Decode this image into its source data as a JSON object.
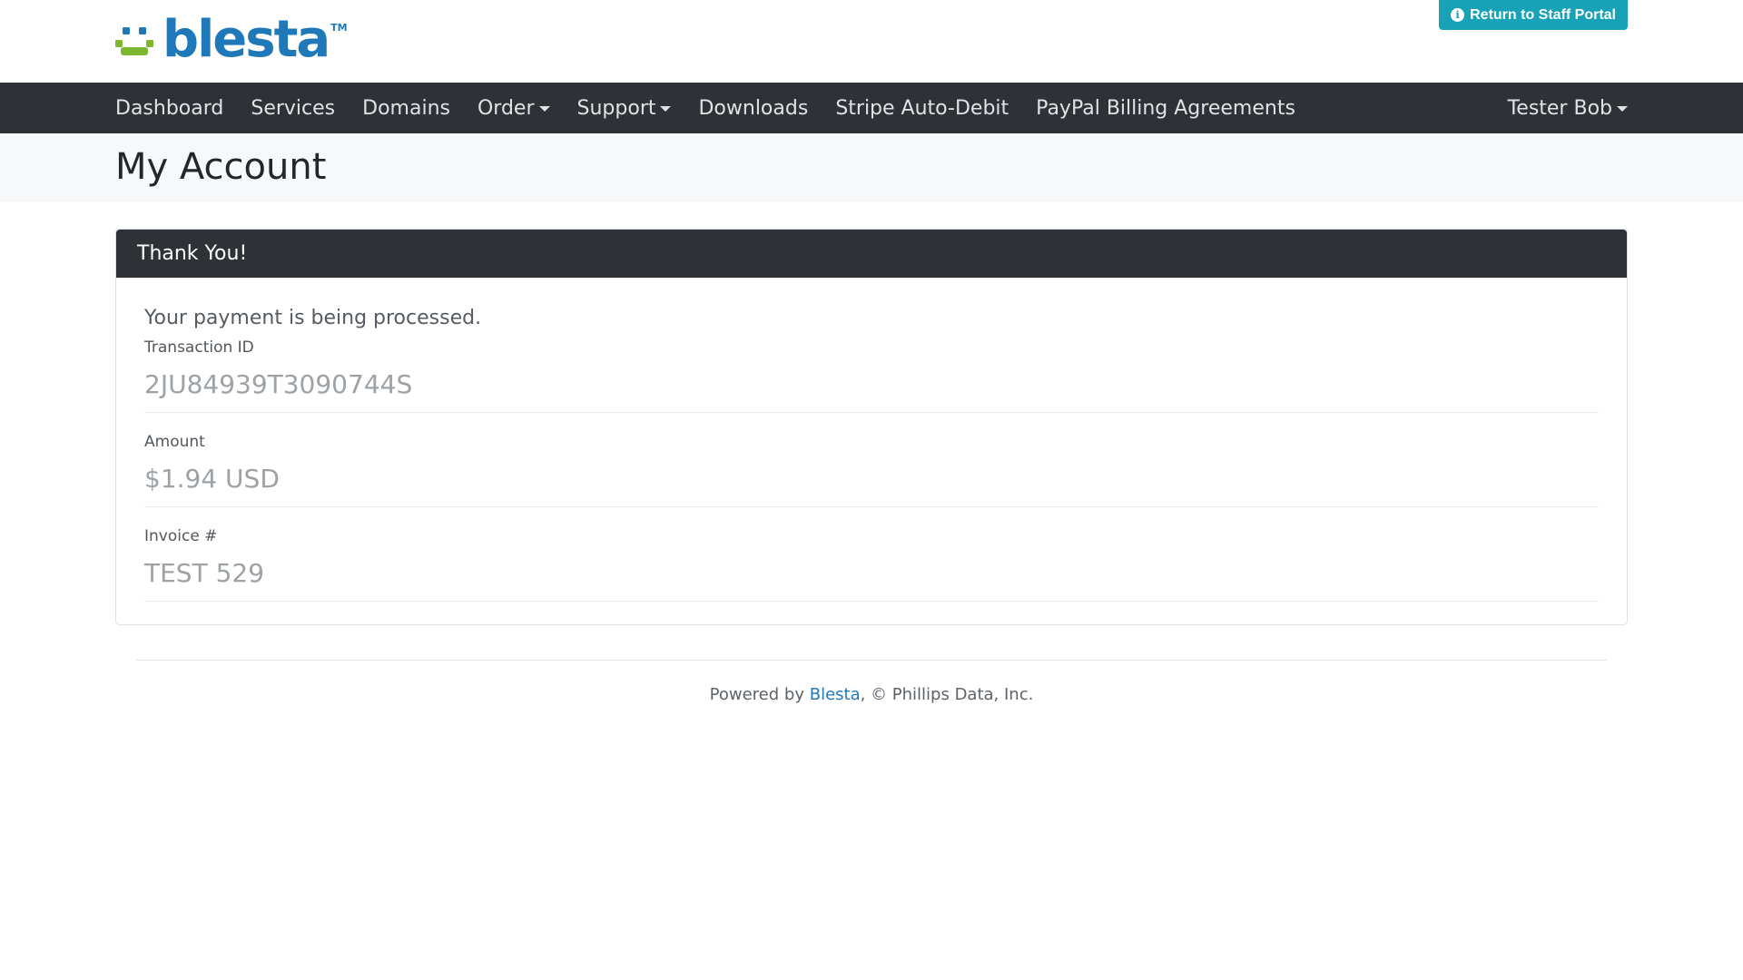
{
  "header": {
    "logo_text": "blesta",
    "logo_tm": "TM",
    "staff_portal_label": "Return to Staff Portal"
  },
  "nav": {
    "items": [
      {
        "label": "Dashboard"
      },
      {
        "label": "Services"
      },
      {
        "label": "Domains"
      },
      {
        "label": "Order"
      },
      {
        "label": "Support"
      },
      {
        "label": "Downloads"
      },
      {
        "label": "Stripe Auto-Debit"
      },
      {
        "label": "PayPal Billing Agreements"
      }
    ],
    "user_label": "Tester Bob"
  },
  "page": {
    "title": "My Account"
  },
  "card": {
    "header": "Thank You!",
    "message": "Your payment is being processed.",
    "fields": [
      {
        "label": "Transaction ID",
        "value": "2JU84939T3090744S"
      },
      {
        "label": "Amount",
        "value": "$1.94 USD"
      },
      {
        "label": "Invoice #",
        "value": "TEST 529"
      }
    ]
  },
  "footer": {
    "prefix": "Powered by ",
    "link": "Blesta",
    "suffix": ", © Phillips Data, Inc."
  },
  "colors": {
    "brand_blue": "#1f79b8",
    "brand_green": "#7cb82f",
    "nav_bg": "#2e3237",
    "staff_button": "#17a2b8"
  }
}
